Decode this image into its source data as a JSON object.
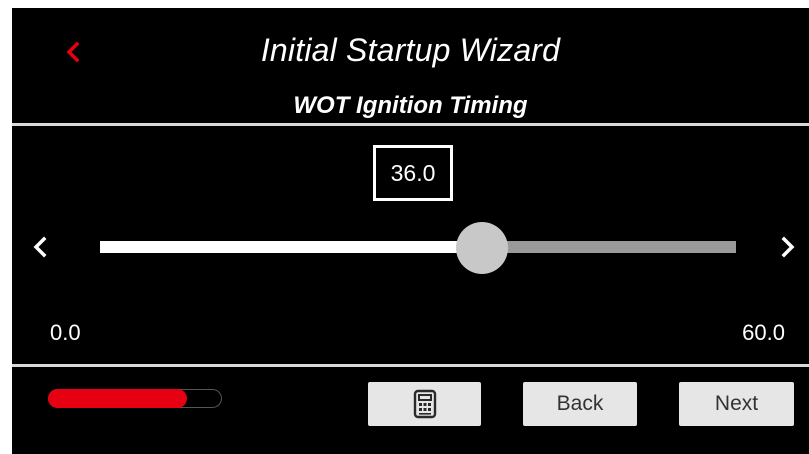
{
  "header": {
    "title": "Initial Startup Wizard",
    "subtitle": "WOT Ignition Timing",
    "back_icon": "chevron-left-icon"
  },
  "slider": {
    "value_display": "36.0",
    "value": 36.0,
    "min": 0.0,
    "max": 60.0,
    "min_label": "0.0",
    "max_label": "60.0",
    "decrement_icon": "chevron-left-icon",
    "increment_icon": "chevron-right-icon"
  },
  "footer": {
    "wizard_progress": 0.8,
    "calculator_icon": "calculator-icon",
    "back_label": "Back",
    "next_label": "Next"
  },
  "colors": {
    "background": "#000000",
    "accent_red": "#e60012",
    "track_fill": "#ffffff",
    "track_rest": "#9a9a9a",
    "thumb": "#c8c8c8",
    "button_bg": "#e6e6e6"
  }
}
